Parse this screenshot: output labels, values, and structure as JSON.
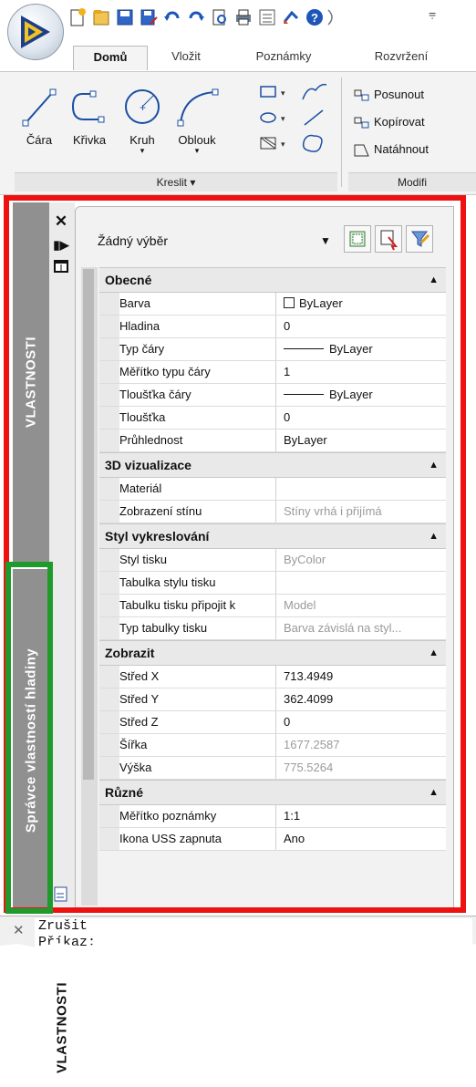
{
  "ribbon": {
    "tabs": [
      "Domů",
      "Vložit",
      "Poznámky",
      "Rozvržení"
    ],
    "draw_tools": [
      {
        "label": "Čára",
        "icon": "line-icon"
      },
      {
        "label": "Křivka",
        "icon": "polyline-icon"
      },
      {
        "label": "Kruh",
        "icon": "circle-icon"
      },
      {
        "label": "Oblouk",
        "icon": "arc-icon"
      }
    ],
    "draw_panel_title": "Kreslit ▾",
    "modify_items": [
      "Posunout",
      "Kopírovat",
      "Natáhnout"
    ],
    "modify_panel_title": "Modifi"
  },
  "side_tabs": {
    "properties": "VLASTNOSTI",
    "layer_manager": "Správce vlastností hladiny",
    "palette_label": "VLASTNOSTI"
  },
  "properties": {
    "selection": "Žádný výběr",
    "categories": [
      {
        "name": "Obecné",
        "rows": [
          {
            "name": "Barva",
            "value": "ByLayer",
            "kind": "color"
          },
          {
            "name": "Hladina",
            "value": "0"
          },
          {
            "name": "Typ čáry",
            "value": "ByLayer",
            "kind": "line"
          },
          {
            "name": "Měřítko typu čáry",
            "value": "1"
          },
          {
            "name": "Tloušťka čáry",
            "value": "ByLayer",
            "kind": "line"
          },
          {
            "name": "Tloušťka",
            "value": "0"
          },
          {
            "name": "Průhlednost",
            "value": "ByLayer"
          }
        ]
      },
      {
        "name": "3D vizualizace",
        "rows": [
          {
            "name": "Materiál",
            "value": ""
          },
          {
            "name": "Zobrazení stínu",
            "value": "Stíny vrhá i přijímá",
            "gray": true
          }
        ]
      },
      {
        "name": "Styl vykreslování",
        "rows": [
          {
            "name": "Styl tisku",
            "value": "ByColor",
            "gray": true
          },
          {
            "name": "Tabulka stylu tisku",
            "value": ""
          },
          {
            "name": "Tabulku tisku připojit k",
            "value": "Model",
            "gray": true
          },
          {
            "name": "Typ tabulky tisku",
            "value": "Barva závislá na styl...",
            "gray": true
          }
        ]
      },
      {
        "name": "Zobrazit",
        "rows": [
          {
            "name": "Střed X",
            "value": "713.4949"
          },
          {
            "name": "Střed Y",
            "value": "362.4099"
          },
          {
            "name": "Střed Z",
            "value": "0"
          },
          {
            "name": "Šířka",
            "value": "1677.2587",
            "gray": true
          },
          {
            "name": "Výška",
            "value": "775.5264",
            "gray": true
          }
        ]
      },
      {
        "name": "Různé",
        "rows": [
          {
            "name": "Měřítko poznámky",
            "value": "1:1"
          },
          {
            "name": "Ikona USS zapnuta",
            "value": "Ano"
          }
        ]
      }
    ]
  },
  "command": {
    "line1": "Zrušit",
    "line2": "Příkaz:"
  },
  "colors": {
    "highlight_red": "#ee1111",
    "highlight_green": "#1f9b2c",
    "side_tab_gray": "#909090"
  }
}
